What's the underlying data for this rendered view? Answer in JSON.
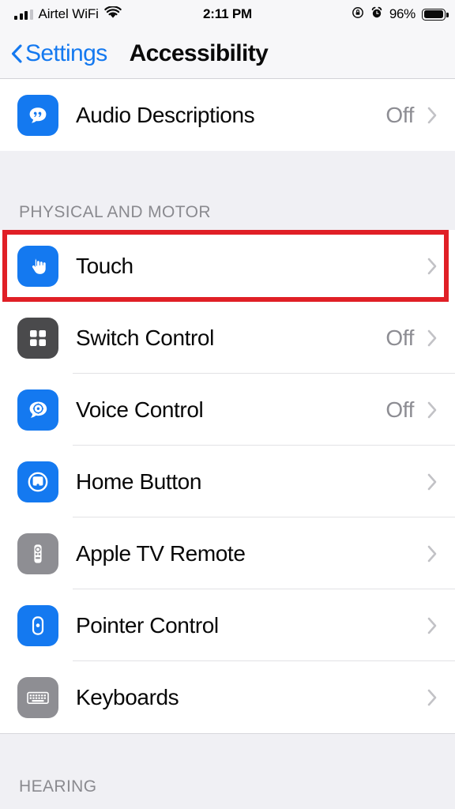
{
  "status_bar": {
    "carrier": "Airtel WiFi",
    "time": "2:11 PM",
    "battery_percent": "96%",
    "icons": {
      "signal": "cellular-signal-icon",
      "wifi": "wifi-icon",
      "rotation_lock": "rotation-lock-icon",
      "alarm": "alarm-clock-icon",
      "battery": "battery-icon"
    }
  },
  "nav_bar": {
    "back_label": "Settings",
    "back_icon": "chevron-left-icon",
    "title": "Accessibility"
  },
  "colors": {
    "accent_blue": "#1479f0",
    "icon_blue": "#1479f0",
    "icon_dark_gray": "#4a4a4c",
    "icon_gray": "#8e8e93",
    "highlight_red": "#e01f26",
    "secondary_text": "#8d8d93",
    "group_bg": "#f0f0f4"
  },
  "sections": [
    {
      "header": "",
      "rows": [
        {
          "label": "Audio Descriptions",
          "value": "Off",
          "icon": "audio-descriptions-icon",
          "icon_style": "blue",
          "highlighted": false
        }
      ]
    },
    {
      "header": "PHYSICAL AND MOTOR",
      "rows": [
        {
          "label": "Touch",
          "value": "",
          "icon": "touch-hand-icon",
          "icon_style": "blue",
          "highlighted": true
        },
        {
          "label": "Switch Control",
          "value": "Off",
          "icon": "switch-control-grid-icon",
          "icon_style": "dark",
          "highlighted": false
        },
        {
          "label": "Voice Control",
          "value": "Off",
          "icon": "voice-control-icon",
          "icon_style": "blue",
          "highlighted": false
        },
        {
          "label": "Home Button",
          "value": "",
          "icon": "home-button-icon",
          "icon_style": "blue",
          "highlighted": false
        },
        {
          "label": "Apple TV Remote",
          "value": "",
          "icon": "apple-tv-remote-icon",
          "icon_style": "gray",
          "highlighted": false
        },
        {
          "label": "Pointer Control",
          "value": "",
          "icon": "pointer-control-icon",
          "icon_style": "blue",
          "highlighted": false
        },
        {
          "label": "Keyboards",
          "value": "",
          "icon": "keyboards-icon",
          "icon_style": "gray",
          "highlighted": false
        }
      ]
    },
    {
      "header": "HEARING",
      "rows": []
    }
  ]
}
